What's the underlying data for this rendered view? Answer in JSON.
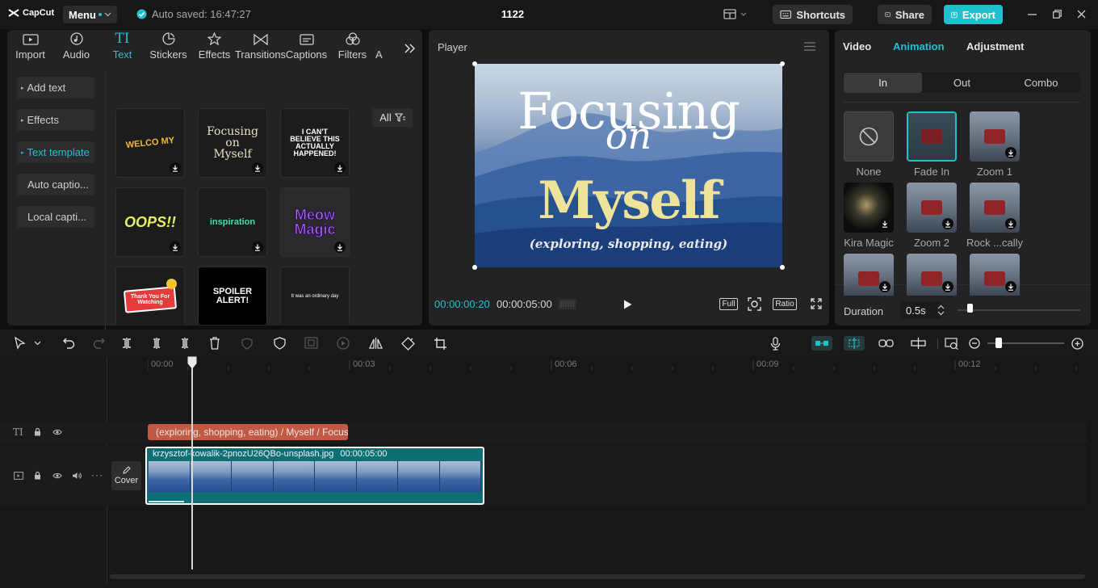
{
  "app": {
    "logo": "CapCut",
    "menu_label": "Menu",
    "autosave": "Auto saved: 16:47:27",
    "project_title": "1122",
    "shortcuts_label": "Shortcuts",
    "share_label": "Share",
    "export_label": "Export"
  },
  "media_tabs": [
    {
      "label": "Import",
      "icon": "import-icon"
    },
    {
      "label": "Audio",
      "icon": "audio-icon"
    },
    {
      "label": "Text",
      "icon": "text-icon"
    },
    {
      "label": "Stickers",
      "icon": "sticker-icon"
    },
    {
      "label": "Effects",
      "icon": "effects-icon"
    },
    {
      "label": "Transitions",
      "icon": "transitions-icon"
    },
    {
      "label": "Captions",
      "icon": "captions-icon"
    },
    {
      "label": "Filters",
      "icon": "filters-icon"
    },
    {
      "label": "A",
      "icon": "adjustment-icon"
    }
  ],
  "text_nav": [
    {
      "label": "Add text"
    },
    {
      "label": "Effects"
    },
    {
      "label": "Text template"
    },
    {
      "label": "Auto captio..."
    },
    {
      "label": "Local capti..."
    }
  ],
  "filter_label": "All",
  "templates": [
    {
      "text": "WELCO MY",
      "sub": ""
    },
    {
      "text": "Focusing on Myself",
      "sub": ""
    },
    {
      "text": "I CAN'T BELIEVE THIS ACTUALLY HAPPENED!",
      "sub": ""
    },
    {
      "text": "OOPS!!",
      "sub": ""
    },
    {
      "text": "inspiration",
      "sub": ""
    },
    {
      "text": "Meow Magic",
      "sub": ""
    },
    {
      "text": "Thank You For Watching",
      "sub": ""
    },
    {
      "text": "SPOILER ALERT!",
      "sub": ""
    },
    {
      "text": "It was an ordinary day",
      "sub": ""
    }
  ],
  "player": {
    "title": "Player",
    "overlay_line1": "Focusing",
    "overlay_line2": "on",
    "overlay_line3": "Myself",
    "overlay_line4": "(exploring, shopping, eating)",
    "current_time": "00:00:00:20",
    "total_time": "00:00:05:00",
    "full_label": "Full",
    "ratio_label": "Ratio"
  },
  "inspector": {
    "tabs": [
      "Video",
      "Animation",
      "Adjustment"
    ],
    "anim_tabs": [
      "In",
      "Out",
      "Combo"
    ],
    "animations": [
      {
        "label": "None"
      },
      {
        "label": "Fade In"
      },
      {
        "label": "Zoom 1"
      },
      {
        "label": "Kira Magic"
      },
      {
        "label": "Zoom 2"
      },
      {
        "label": "Rock ...cally"
      },
      {
        "label": ""
      },
      {
        "label": ""
      },
      {
        "label": ""
      }
    ],
    "duration_label": "Duration",
    "duration_value": "0.5s",
    "duration_fraction": 0.1
  },
  "timeline": {
    "ticks": [
      "00:00",
      "00:03",
      "00:06",
      "00:09",
      "00:12"
    ],
    "text_clip": "(exploring, shopping, eating) / Myself / Focusing",
    "video_clip_name": "krzysztof-kowalik-2pnozU26QBo-unsplash.jpg",
    "video_clip_duration": "00:00:05:00",
    "cover_label": "Cover",
    "zoom_fraction": 0.25
  },
  "colors": {
    "accent": "#22c0cc",
    "text_clip": "#c05a45",
    "video_clip": "#0f6e73"
  }
}
